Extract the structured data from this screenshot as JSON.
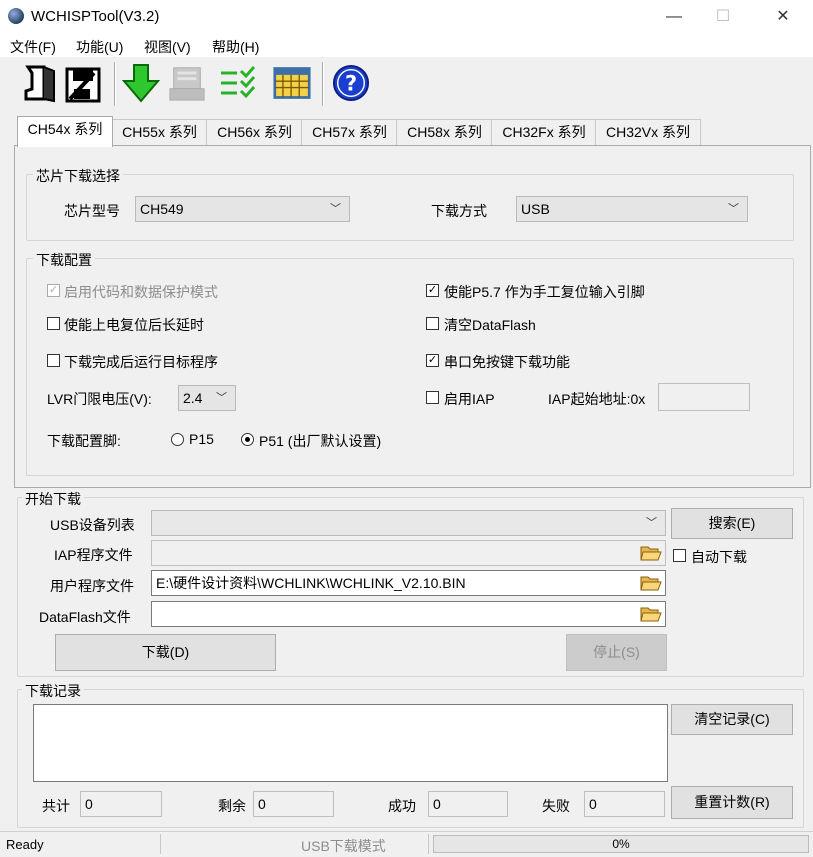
{
  "window": {
    "title": "WCHISPTool(V3.2)",
    "min": "—",
    "max": "☐",
    "close": "✕"
  },
  "menu": [
    "文件(F)",
    "功能(U)",
    "视图(V)",
    "帮助(H)"
  ],
  "toolbar_icons": [
    "open-icon",
    "save-icon",
    "download-arrow-icon",
    "chip-icon",
    "checklist-icon",
    "calendar-grid-icon",
    "help-icon"
  ],
  "tabs": [
    "CH54x 系列",
    "CH55x 系列",
    "CH56x 系列",
    "CH57x 系列",
    "CH58x 系列",
    "CH32Fx 系列",
    "CH32Vx  系列"
  ],
  "chip_select": {
    "group_label": "芯片下载选择",
    "chip_model_label": "芯片型号",
    "chip_model_value": "CH549",
    "download_mode_label": "下载方式",
    "download_mode_value": "USB"
  },
  "download_config": {
    "group_label": "下载配置",
    "enable_code_protect": {
      "label": "启用代码和数据保护模式",
      "checked": true,
      "disabled": true
    },
    "enable_p57_reset": {
      "label": "使能P5.7 作为手工复位输入引脚",
      "checked": true
    },
    "power_on_reset_delay": {
      "label": "使能上电复位后长延时",
      "checked": false
    },
    "clear_dataflash": {
      "label": "清空DataFlash",
      "checked": false
    },
    "run_after_download": {
      "label": "下载完成后运行目标程序",
      "checked": false
    },
    "serial_no_key": {
      "label": "串口免按键下载功能",
      "checked": true
    },
    "lvr_label": "LVR门限电压(V):",
    "lvr_value": "2.4",
    "enable_iap": {
      "label": "启用IAP",
      "checked": false
    },
    "iap_addr_label": "IAP起始地址:0x",
    "iap_addr_value": "",
    "pin_label": "下载配置脚:",
    "pin_p15": "P15",
    "pin_p51": "P51 (出厂默认设置)",
    "pin_selected": "P51"
  },
  "start_download": {
    "group_label": "开始下载",
    "usb_list_label": "USB设备列表",
    "usb_list_value": "",
    "search_button": "搜索(E)",
    "iap_file_label": "IAP程序文件",
    "iap_file_value": "",
    "auto_download_label": "自动下载",
    "user_file_label": "用户程序文件",
    "user_file_value": "E:\\硬件设计资料\\WCHLINK\\WCHLINK_V2.10.BIN",
    "dataflash_file_label": "DataFlash文件",
    "dataflash_file_value": "",
    "download_button": "下载(D)",
    "stop_button": "停止(S)"
  },
  "log": {
    "group_label": "下载记录",
    "clear_button": "清空记录(C)",
    "total_label": "共计",
    "total_value": "0",
    "remain_label": "剩余",
    "remain_value": "0",
    "success_label": "成功",
    "success_value": "0",
    "fail_label": "失败",
    "fail_value": "0",
    "reset_button": "重置计数(R)"
  },
  "status": {
    "ready": "Ready",
    "mode": "USB下载模式",
    "progress": "0%",
    "progress_fraction": 0
  }
}
